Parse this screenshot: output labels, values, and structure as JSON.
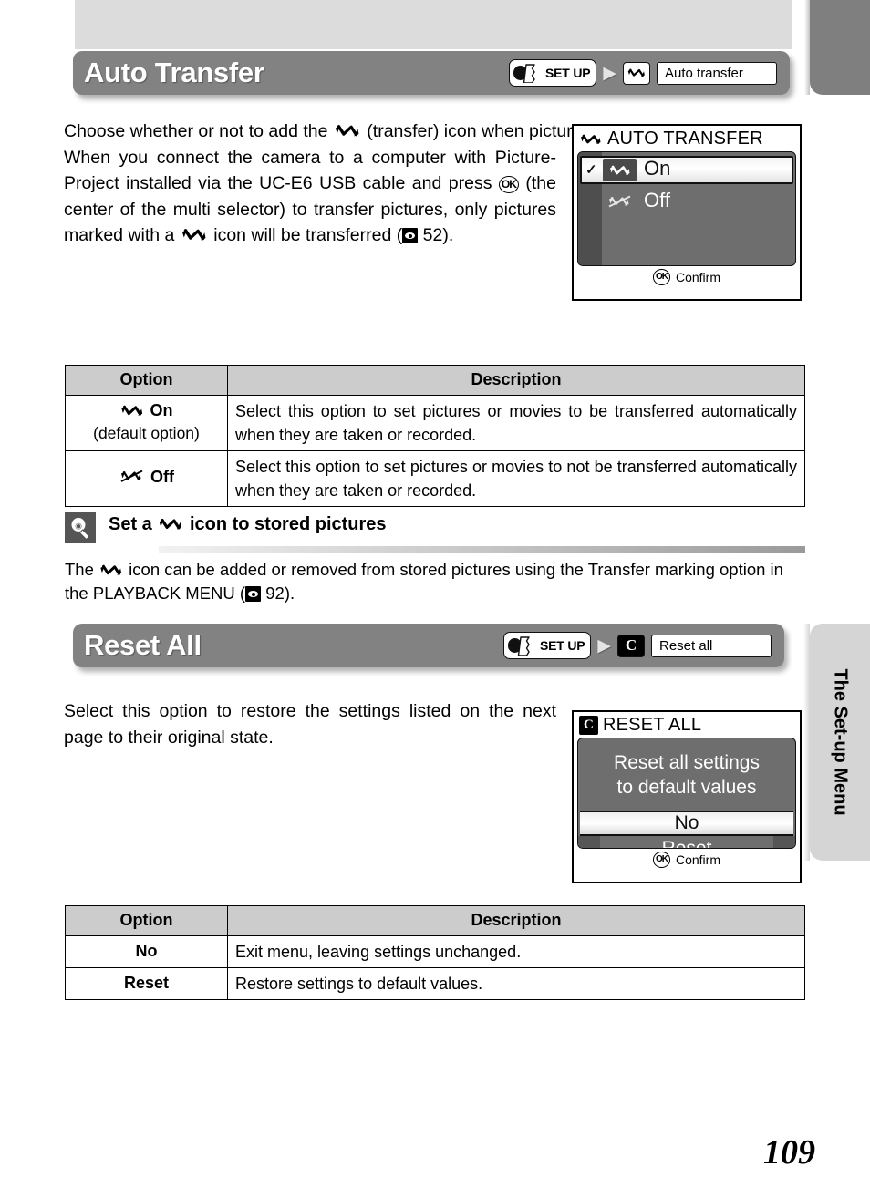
{
  "page": {
    "number": "109",
    "side_tab_label": "The Set-up Menu"
  },
  "sections": [
    {
      "title": "Auto Transfer",
      "breadcrumb": {
        "mode_label": "SET UP",
        "icon": "transfer-icon",
        "field_value": "Auto transfer"
      },
      "body": {
        "para1": "Choose whether or not to add the",
        "para1_b": "(transfer) icon when pictures are taken.",
        "para2_a": "When you connect the camera to a computer with Picture-Project installed via the UC-E6 USB cable and press",
        "para2_ok": "OK",
        "para2_b": "(the center of the multi selector) to transfer pictures, only pictures marked with a",
        "para2_c": "icon will be transferred (",
        "para2_ref": "52",
        "para2_d": ")."
      },
      "lcd": {
        "title": "AUTO TRANSFER",
        "title_icon": "transfer-icon",
        "items": [
          {
            "label": "On",
            "icon": "transfer-icon",
            "selected": true,
            "checked": true
          },
          {
            "label": "Off",
            "icon": "transfer-off-icon",
            "selected": false,
            "checked": false
          }
        ],
        "footer": {
          "button": "OK",
          "label": "Confirm"
        }
      },
      "table": {
        "headers": [
          "Option",
          "Description"
        ],
        "rows": [
          {
            "option": "On",
            "option_icon": "transfer-icon",
            "option_note": "(default option)",
            "description": "Select this option to set pictures or movies to be transferred automatically when they are taken or recorded."
          },
          {
            "option": "Off",
            "option_icon": "transfer-off-icon",
            "option_note": "",
            "description": "Select this option to set pictures or movies to not be transferred automatically when they are taken or recorded."
          }
        ]
      },
      "tip": {
        "icon": "light-bulb-icon",
        "title_a": "Set a",
        "title_icon": "transfer-icon",
        "title_b": "icon to stored pictures",
        "text_a": "The",
        "text_icon": "transfer-icon",
        "text_b": "icon can be added or removed from stored pictures using the Transfer marking option in the PLAYBACK MENU (",
        "text_ref": "92",
        "text_c": ")."
      }
    },
    {
      "title": "Reset All",
      "breadcrumb": {
        "mode_label": "SET UP",
        "icon": "reset-c-icon",
        "icon_glyph": "C",
        "field_value": "Reset all"
      },
      "body": {
        "para1": "Select this option to restore the settings listed on the next page to their original state."
      },
      "lcd": {
        "title": "RESET ALL",
        "title_icon": "reset-c-icon",
        "title_icon_glyph": "C",
        "message_line1": "Reset all settings",
        "message_line2": "to default values",
        "buttons": [
          {
            "label": "No",
            "selected": true
          },
          {
            "label": "Reset",
            "selected": false
          }
        ],
        "footer": {
          "button": "OK",
          "label": "Confirm"
        }
      },
      "table": {
        "headers": [
          "Option",
          "Description"
        ],
        "rows": [
          {
            "option": "No",
            "description": "Exit menu, leaving settings unchanged."
          },
          {
            "option": "Reset",
            "description": "Restore settings to default values."
          }
        ]
      }
    }
  ],
  "colors": {
    "heading_bar": "#828282",
    "table_header": "#cccccc",
    "lcd_body": "#6e6e6e",
    "side_tab": "#d5d5d5",
    "top_tab": "#7f7f7f"
  }
}
